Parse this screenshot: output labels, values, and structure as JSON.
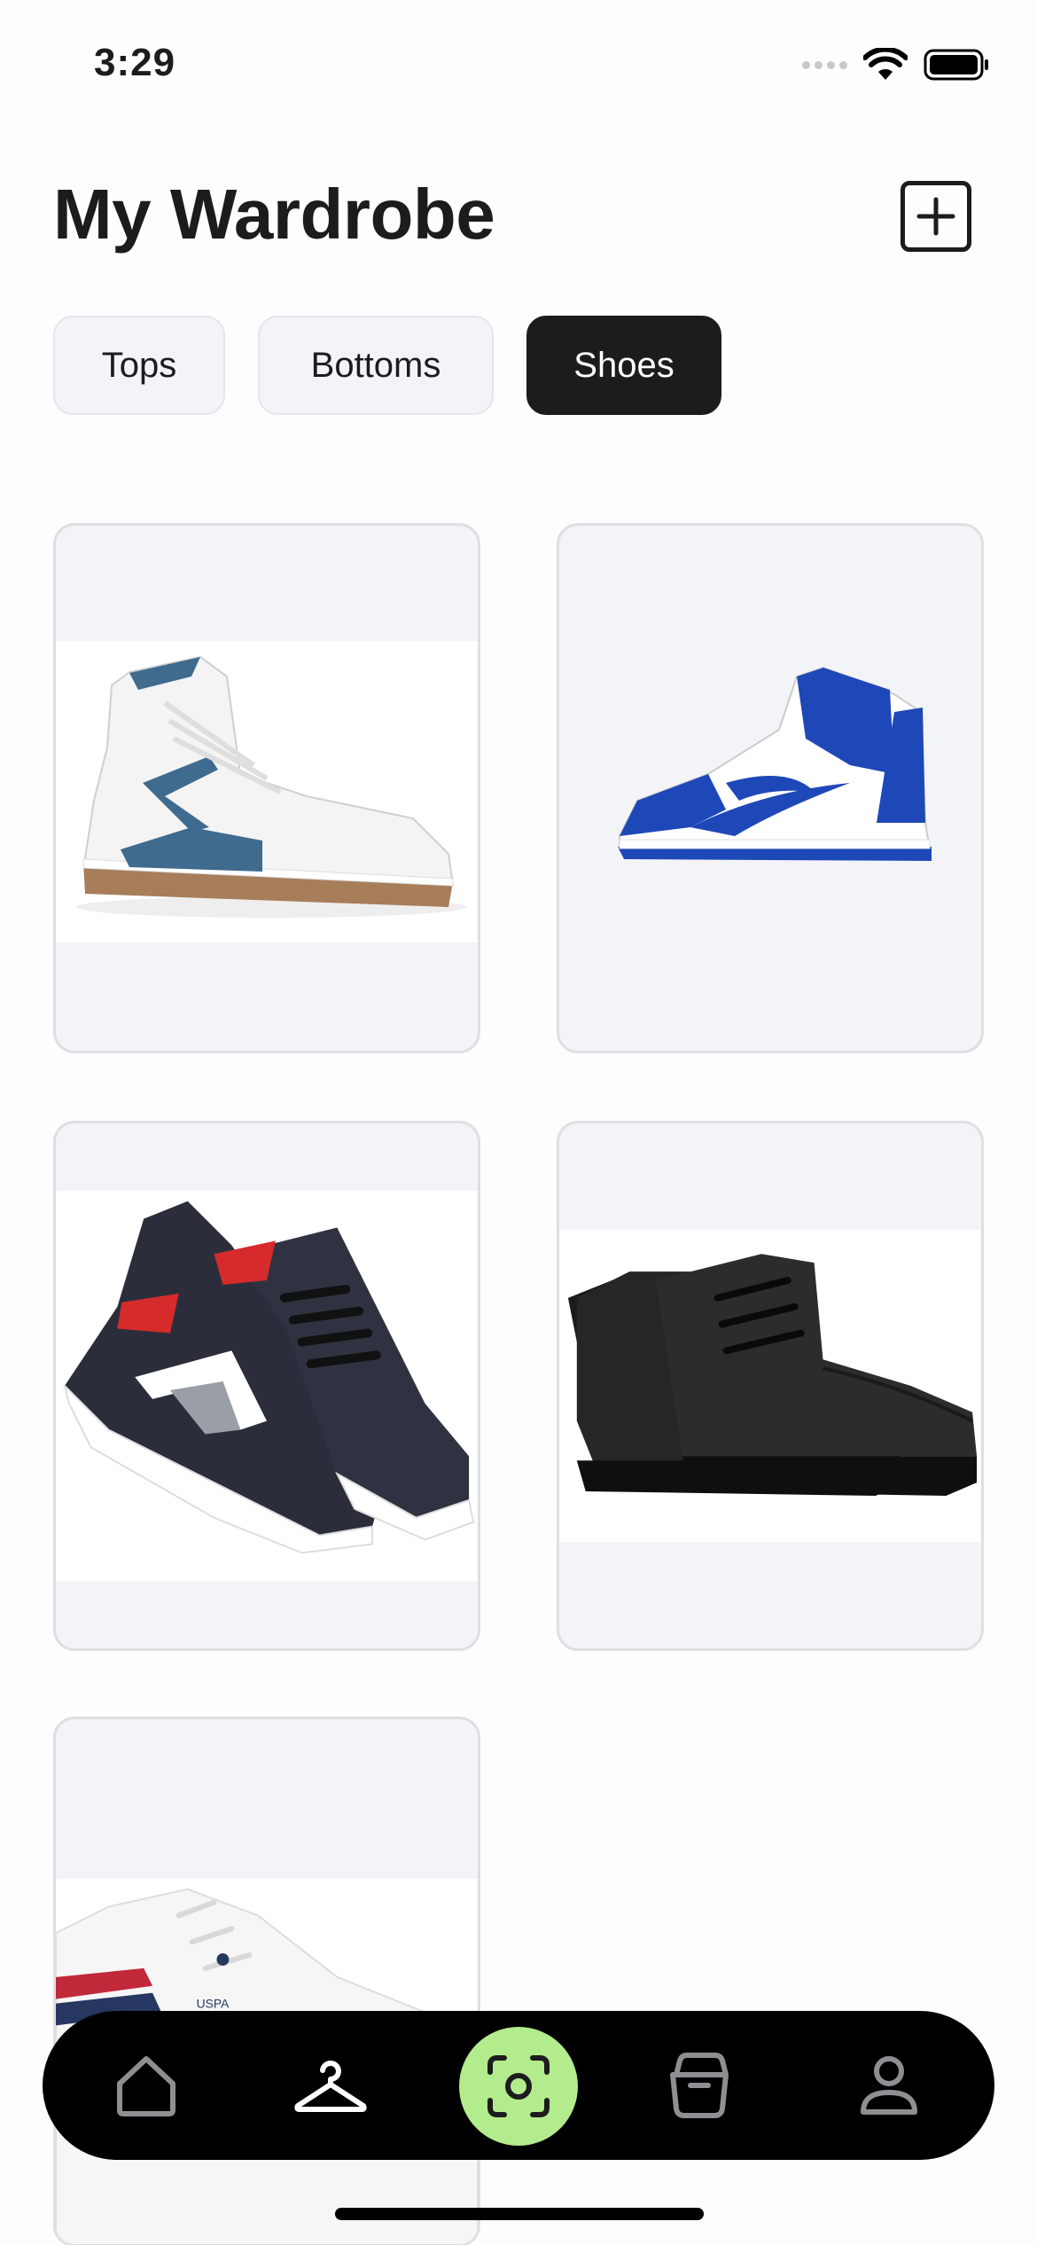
{
  "status_bar": {
    "time": "3:29"
  },
  "header": {
    "title": "My Wardrobe",
    "add_icon": "plus-square-icon"
  },
  "filters": {
    "chips": [
      {
        "label": "Tops",
        "selected": false
      },
      {
        "label": "Bottoms",
        "selected": false
      },
      {
        "label": "Shoes",
        "selected": true
      }
    ]
  },
  "wardrobe_items": [
    {
      "category": "Shoes",
      "description": "white high-top sneaker with navy accents"
    },
    {
      "category": "Shoes",
      "description": "blue and white high-top sneaker"
    },
    {
      "category": "Shoes",
      "description": "navy sneakers with red and white panels"
    },
    {
      "category": "Shoes",
      "description": "black leather lace-up boots"
    },
    {
      "category": "Shoes",
      "description": "white sneaker with red and navy stripes"
    }
  ],
  "tab_bar": {
    "items": [
      {
        "icon": "home-icon",
        "selected": false
      },
      {
        "icon": "hanger-icon",
        "selected": true
      },
      {
        "icon": "scan-icon",
        "selected": false
      },
      {
        "icon": "basket-icon",
        "selected": false
      },
      {
        "icon": "profile-icon",
        "selected": false
      }
    ],
    "accent_color": "#b3ec8c"
  },
  "colors": {
    "primary": "#1c1c1e",
    "card_bg": "#f3f4f8",
    "card_border": "#dedfe3"
  }
}
